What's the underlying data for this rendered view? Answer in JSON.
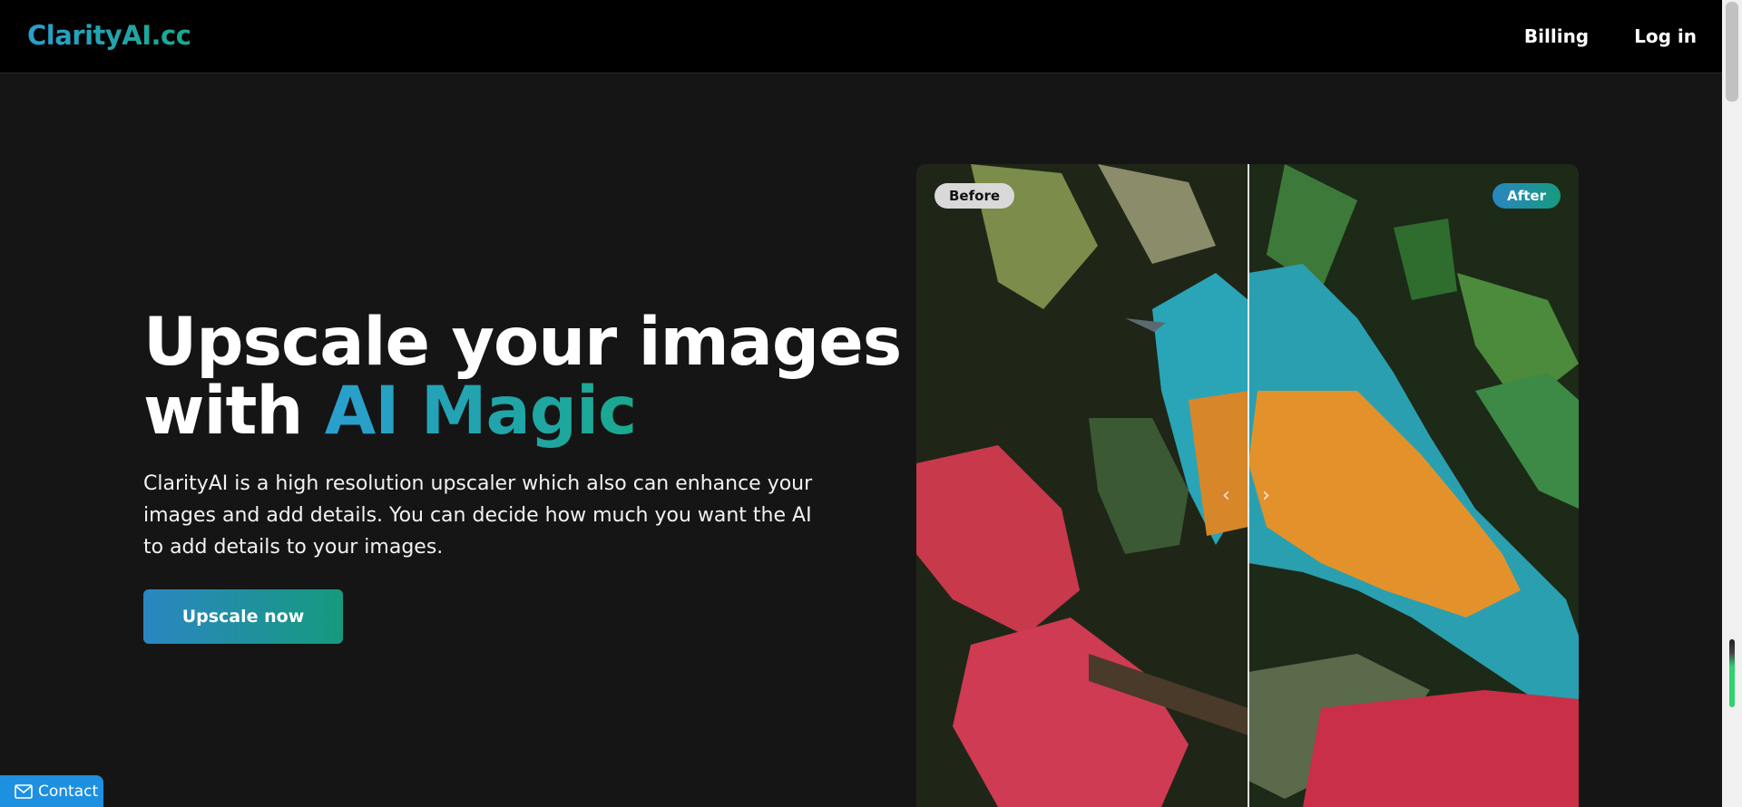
{
  "header": {
    "logo": "ClarityAI.cc",
    "nav": [
      {
        "label": "Billing"
      },
      {
        "label": "Log in"
      }
    ]
  },
  "hero": {
    "title_line1": "Upscale your images",
    "title_line2_prefix": "with ",
    "title_highlight": "AI Magic",
    "description": "ClarityAI is a high resolution upscaler which also can enhance your images and add details. You can decide how much you want the AI to add details to your images.",
    "cta_label": "Upscale now"
  },
  "comparison": {
    "before_label": "Before",
    "after_label": "After",
    "divider_position_percent": 50
  },
  "contact": {
    "label": "Contact"
  },
  "colors": {
    "background": "#151515",
    "header": "#000000",
    "gradient_start": "#2a9fd0",
    "gradient_end": "#1aa98d",
    "contact": "#1e90e0"
  }
}
